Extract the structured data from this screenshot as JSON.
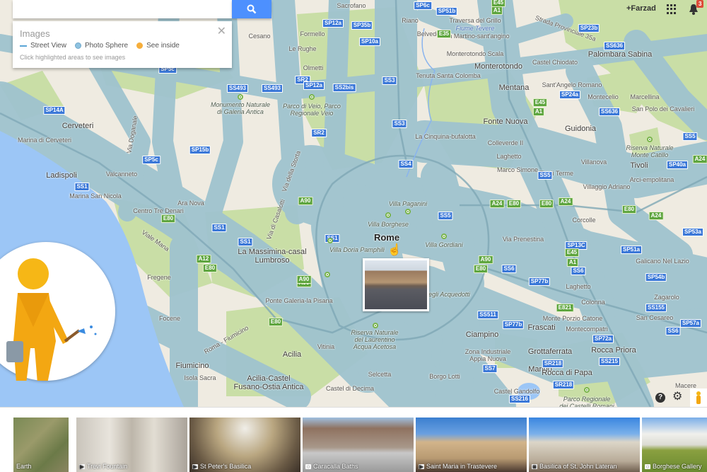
{
  "search": {
    "value": "",
    "placeholder": "",
    "button_icon": "search-icon"
  },
  "images_panel": {
    "title": "Images",
    "legend": [
      {
        "label": "Street View",
        "color": "#5aa5d6",
        "shape": "line"
      },
      {
        "label": "Photo Sphere",
        "color": "#8ec2e0",
        "shape": "dot"
      },
      {
        "label": "See inside",
        "color": "#f6ae3b",
        "shape": "dot"
      }
    ],
    "hint": "Click highlighted areas to see images",
    "close_icon": "close-icon"
  },
  "account": {
    "user": "+Farzad",
    "notifications": "3"
  },
  "map": {
    "colors": {
      "land": "#efebe1",
      "coverage": "#9fc3cf",
      "park": "#c9dea6",
      "sea": "#9cc6f6"
    },
    "places": [
      {
        "name": "Sacrofano"
      },
      {
        "name": "Cesano"
      },
      {
        "name": "Formello"
      },
      {
        "name": "Riano"
      },
      {
        "name": "Traversa del Grillo"
      },
      {
        "name": "Fiume Tevere",
        "kind": "water"
      },
      {
        "name": "San Martino-sant'angino"
      },
      {
        "name": "Belvedere"
      },
      {
        "name": "Le Rughe"
      },
      {
        "name": "Monterotondo Scala"
      },
      {
        "name": "Monterotondo",
        "size": "m"
      },
      {
        "name": "Castel Chiodato"
      },
      {
        "name": "Palombara Sabina",
        "size": "m"
      },
      {
        "name": "Olmetti"
      },
      {
        "name": "Tenuta Santa Colomba"
      },
      {
        "name": "Mentana",
        "size": "m"
      },
      {
        "name": "Sant'Angelo Romano"
      },
      {
        "name": "Montecelio"
      },
      {
        "name": "Marcellina"
      },
      {
        "name": "San Polo dei Cavalieri"
      },
      {
        "name": "Parco di Veio, Parco\nRegionale Veio",
        "kind": "park"
      },
      {
        "name": "Monumento Naturale\ndi Galeria Antica",
        "kind": "park"
      },
      {
        "name": "Guidonia",
        "size": "m"
      },
      {
        "name": "Cerveteri",
        "size": "m"
      },
      {
        "name": "Fonte Nuova",
        "size": "m"
      },
      {
        "name": "La Cinquina-bufalotta"
      },
      {
        "name": "Marina di Cerveteri"
      },
      {
        "name": "Colleverde II"
      },
      {
        "name": "Riserva Naturale\nMonte Catillo",
        "kind": "park"
      },
      {
        "name": "Villanova"
      },
      {
        "name": "Tivoli",
        "size": "m"
      },
      {
        "name": "Laghetto"
      },
      {
        "name": "Marco Simone"
      },
      {
        "name": "Tivoli Terme"
      },
      {
        "name": "Ladispoli",
        "size": "m"
      },
      {
        "name": "Valcanneto"
      },
      {
        "name": "Villaggio Adriano"
      },
      {
        "name": "Arci-empolitana"
      },
      {
        "name": "Marina San Nicola"
      },
      {
        "name": "Villa Paganini",
        "kind": "park"
      },
      {
        "name": "Ara Nova"
      },
      {
        "name": "Centro Tre Denari"
      },
      {
        "name": "Corcolle"
      },
      {
        "name": "Villa Borghese",
        "kind": "park"
      },
      {
        "name": "Rome",
        "size": "l"
      },
      {
        "name": "Villa Gordiani",
        "kind": "park"
      },
      {
        "name": "Villa Doria Pamphili",
        "kind": "park"
      },
      {
        "name": "La Massimina-casal\nLumbroso",
        "size": "m"
      },
      {
        "name": "Via Prenestina"
      },
      {
        "name": "Galicano Nel Lazio"
      },
      {
        "name": "Fregene"
      },
      {
        "name": "Parco degli Acquedotti",
        "kind": "park"
      },
      {
        "name": "Laghetto"
      },
      {
        "name": "Zagarolo"
      },
      {
        "name": "Ponte Galeria-la Pisana"
      },
      {
        "name": "Colonna"
      },
      {
        "name": "Focene"
      },
      {
        "name": "Monte Porzio Catone"
      },
      {
        "name": "San Cesareo"
      },
      {
        "name": "Frascati",
        "size": "m"
      },
      {
        "name": "Montecompatri"
      },
      {
        "name": "Ciampino",
        "size": "m"
      },
      {
        "name": "Riserva Naturale\ndel Laurentino\nAcqua Acetosa",
        "kind": "park"
      },
      {
        "name": "Vitinia"
      },
      {
        "name": "Acilia",
        "size": "m"
      },
      {
        "name": "Zona Industriale\nAppia Nuova"
      },
      {
        "name": "Grottaferrata",
        "size": "m"
      },
      {
        "name": "Rocca Priora",
        "size": "m"
      },
      {
        "name": "Fiumicino",
        "size": "m"
      },
      {
        "name": "Isola Sacra"
      },
      {
        "name": "Marino",
        "size": "m"
      },
      {
        "name": "Rocca di Papa",
        "size": "m"
      },
      {
        "name": "Borgo Lotti"
      },
      {
        "name": "Selcetta"
      },
      {
        "name": "Acilia-Castel\nFusano-Ostia Antica",
        "size": "m"
      },
      {
        "name": "Castel di Decima"
      },
      {
        "name": "Castel Gandolfo"
      },
      {
        "name": "Parco Regionale\ndei Castelli Romani",
        "kind": "park"
      },
      {
        "name": "Macere"
      },
      {
        "name": "Roma - Fiumicino"
      },
      {
        "name": "Viale Mana"
      },
      {
        "name": "Via della Storta"
      },
      {
        "name": "Via di Casalotti"
      },
      {
        "name": "Via Doganale"
      },
      {
        "name": "Strada Provinciale 35a"
      }
    ],
    "shields": [
      {
        "label": "SP6c",
        "type": "blue"
      },
      {
        "label": "SP51b",
        "type": "blue"
      },
      {
        "label": "SP12a",
        "type": "blue"
      },
      {
        "label": "SP35b",
        "type": "blue"
      },
      {
        "label": "SP10a",
        "type": "blue"
      },
      {
        "label": "SP23b",
        "type": "blue"
      },
      {
        "label": "SS636",
        "type": "blue"
      },
      {
        "label": "SS493",
        "type": "blue"
      },
      {
        "label": "SS493",
        "type": "blue"
      },
      {
        "label": "SR2",
        "type": "blue"
      },
      {
        "label": "SP12a",
        "type": "blue"
      },
      {
        "label": "SS2bis",
        "type": "blue"
      },
      {
        "label": "SS3",
        "type": "blue"
      },
      {
        "label": "SP14A",
        "type": "blue"
      },
      {
        "label": "SP24a",
        "type": "blue"
      },
      {
        "label": "SS636",
        "type": "blue"
      },
      {
        "label": "SS3",
        "type": "blue"
      },
      {
        "label": "SR2",
        "type": "blue"
      },
      {
        "label": "SP15b",
        "type": "blue"
      },
      {
        "label": "SP5c",
        "type": "blue"
      },
      {
        "label": "SS4",
        "type": "blue"
      },
      {
        "label": "SS5",
        "type": "blue"
      },
      {
        "label": "SS5",
        "type": "blue"
      },
      {
        "label": "SP40a",
        "type": "blue"
      },
      {
        "label": "SS1",
        "type": "blue"
      },
      {
        "label": "SS5",
        "type": "blue"
      },
      {
        "label": "SP53a",
        "type": "blue"
      },
      {
        "label": "SS1",
        "type": "blue"
      },
      {
        "label": "SS1",
        "type": "blue"
      },
      {
        "label": "SS1",
        "type": "blue"
      },
      {
        "label": "SP13C",
        "type": "blue"
      },
      {
        "label": "SP51a",
        "type": "blue"
      },
      {
        "label": "SS6",
        "type": "blue"
      },
      {
        "label": "SS6",
        "type": "blue"
      },
      {
        "label": "SP77b",
        "type": "blue"
      },
      {
        "label": "SP54b",
        "type": "blue"
      },
      {
        "label": "SS155",
        "type": "blue"
      },
      {
        "label": "SS511",
        "type": "blue"
      },
      {
        "label": "SP77b",
        "type": "blue"
      },
      {
        "label": "SP57a",
        "type": "blue"
      },
      {
        "label": "SS6",
        "type": "blue"
      },
      {
        "label": "SP72a",
        "type": "blue"
      },
      {
        "label": "SR218",
        "type": "blue"
      },
      {
        "label": "SS7",
        "type": "blue"
      },
      {
        "label": "SS215",
        "type": "blue"
      },
      {
        "label": "SR218",
        "type": "blue"
      },
      {
        "label": "SS216",
        "type": "blue"
      },
      {
        "label": "SP5c",
        "type": "blue"
      },
      {
        "label": "A90",
        "type": "green"
      },
      {
        "label": "A90",
        "type": "green"
      },
      {
        "label": "A12",
        "type": "green"
      },
      {
        "label": "E80",
        "type": "green"
      },
      {
        "label": "E80",
        "type": "green"
      },
      {
        "label": "E80",
        "type": "green"
      },
      {
        "label": "A90",
        "type": "green"
      },
      {
        "label": "E80",
        "type": "green"
      },
      {
        "label": "E35",
        "type": "green"
      },
      {
        "label": "A1",
        "type": "green"
      },
      {
        "label": "A1",
        "type": "green"
      },
      {
        "label": "E45",
        "type": "green"
      },
      {
        "label": "A24",
        "type": "green"
      },
      {
        "label": "E80",
        "type": "green"
      },
      {
        "label": "E80",
        "type": "green"
      },
      {
        "label": "A24",
        "type": "green"
      },
      {
        "label": "E80",
        "type": "green"
      },
      {
        "label": "A24",
        "type": "green"
      },
      {
        "label": "A24",
        "type": "green"
      },
      {
        "label": "A1",
        "type": "green"
      },
      {
        "label": "E45",
        "type": "green"
      },
      {
        "label": "E821",
        "type": "green"
      },
      {
        "label": "A90",
        "type": "green"
      },
      {
        "label": "E45",
        "type": "green"
      }
    ]
  },
  "controls": {
    "help": "?",
    "settings_icon": "gear-icon",
    "pegman_icon": "pegman-icon"
  },
  "photo_strip": [
    {
      "label": "Earth",
      "icon": ""
    },
    {
      "label": "Trevi Fountain",
      "icon": "video-icon"
    },
    {
      "label": "St Peter's Basilica",
      "icon": "video-icon"
    },
    {
      "label": "Caracalla Baths",
      "icon": "photo-sphere-icon"
    },
    {
      "label": "Saint Maria in Trastevere",
      "icon": "video-icon"
    },
    {
      "label": "Basilica of St. John Lateran",
      "icon": "camera-icon"
    },
    {
      "label": "Borghese Gallery",
      "icon": "photo-sphere-icon"
    }
  ]
}
